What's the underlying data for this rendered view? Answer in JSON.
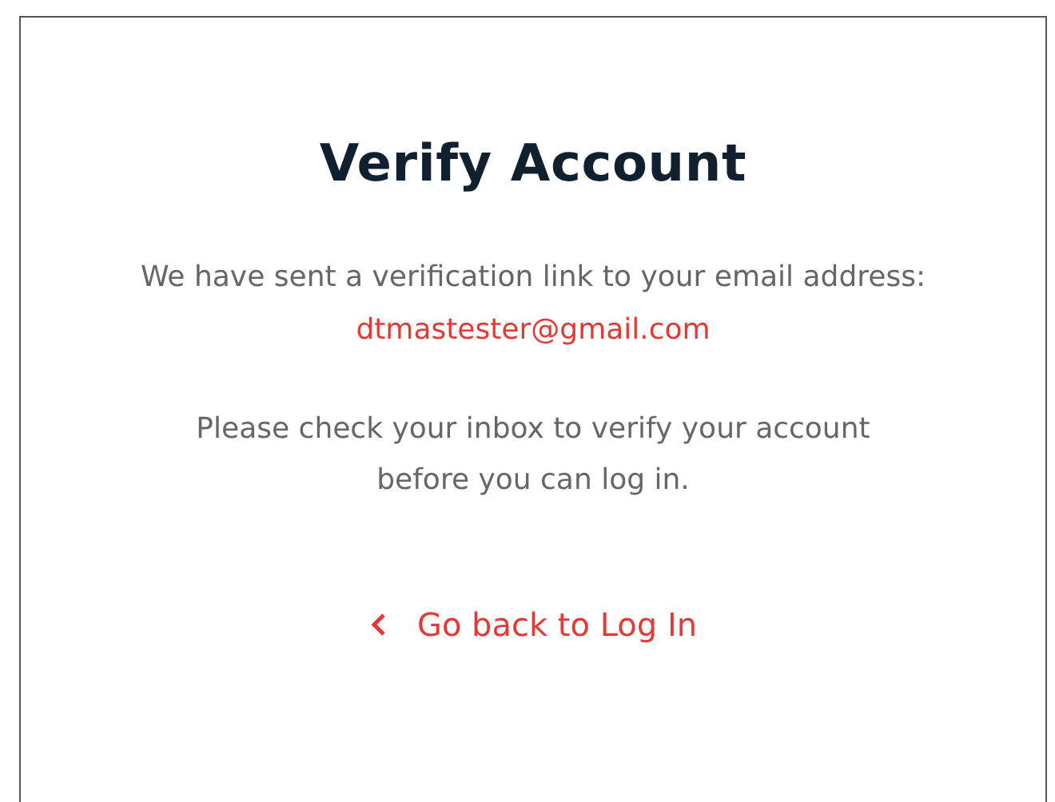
{
  "title": "Verify Account",
  "message": "We have sent a verification link to your email address:",
  "email": "dtmastester@gmail.com",
  "instructions": "Please check your inbox to verify your account before you can log in.",
  "back_link": "Go back to Log In"
}
